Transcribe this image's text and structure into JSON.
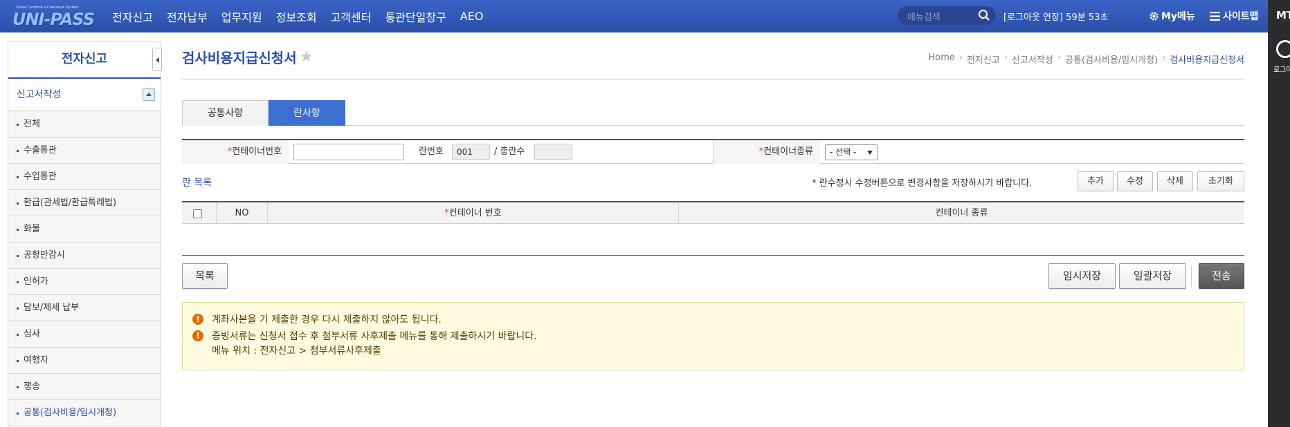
{
  "header": {
    "logo_sub": "Korea Customs e-Clearance System",
    "logo_main": "UNI-PASS",
    "gnb": [
      "전자신고",
      "전자납부",
      "업무지원",
      "정보조회",
      "고객센터",
      "통관단일창구",
      "AEO"
    ],
    "search_placeholder": "메뉴검색",
    "logout_text": "[로그아웃 연장] 59분 53초",
    "mymenu": "My메뉴",
    "sitemap": "사이트맵",
    "mt": "MT"
  },
  "rightbar": {
    "label": "로그아"
  },
  "sidebar": {
    "title": "전자신고",
    "section": "신고서작성",
    "items": [
      {
        "label": "전체"
      },
      {
        "label": "수출통관"
      },
      {
        "label": "수입통관"
      },
      {
        "label": "환급(관세법/환급특례법)"
      },
      {
        "label": "화물"
      },
      {
        "label": "공항만감시"
      },
      {
        "label": "인허가"
      },
      {
        "label": "담보/제세 납부"
      },
      {
        "label": "심사"
      },
      {
        "label": "여행자"
      },
      {
        "label": "쟁송"
      },
      {
        "label": "공통(검사비용/임시개청)"
      }
    ]
  },
  "page": {
    "title": "검사비용지급신청서",
    "breadcrumb": [
      "Home",
      "전자신고",
      "신고서작성",
      "공통(검사비용/임시개청)",
      "검사비용지급신청서"
    ]
  },
  "tabs": [
    "공통사항",
    "란사항"
  ],
  "form": {
    "container_no_label": "컨테이너번호",
    "container_no_value": "",
    "ran_no_label": "란번호",
    "ran_no_value": "001",
    "total_label": "/ 총란수",
    "total_value": "",
    "container_type_label": "컨테이너종류",
    "container_type_selected": "- 선택 -"
  },
  "list": {
    "title": "란 목록",
    "notice": "* 란수정시 수정버튼으로 변경사항을 저장하시기 바랍니다.",
    "buttons": {
      "add": "추가",
      "edit": "수정",
      "delete": "삭제",
      "reset": "초기화"
    },
    "headers": {
      "no": "NO",
      "container_no": "컨테이너 번호",
      "container_type": "컨테이너 종류"
    }
  },
  "bottom": {
    "list": "목록",
    "temp_save": "임시저장",
    "bulk_save": "일괄저장",
    "send": "전송"
  },
  "info": [
    "계좌사본을 기 제출한 경우 다시 제출하지 않아도 됩니다.",
    "증빙서류는 신청서 접수 후 첨부서류 사후제출 메뉴를 통해 제출하시기 바랍니다.",
    "메뉴 위치 : 전자신고 > 첨부서류사후제출"
  ],
  "colors": {
    "brand": "#2b4fa8",
    "active_tab": "#3d6fd0",
    "required": "#e33333",
    "warning": "#e66b00"
  }
}
